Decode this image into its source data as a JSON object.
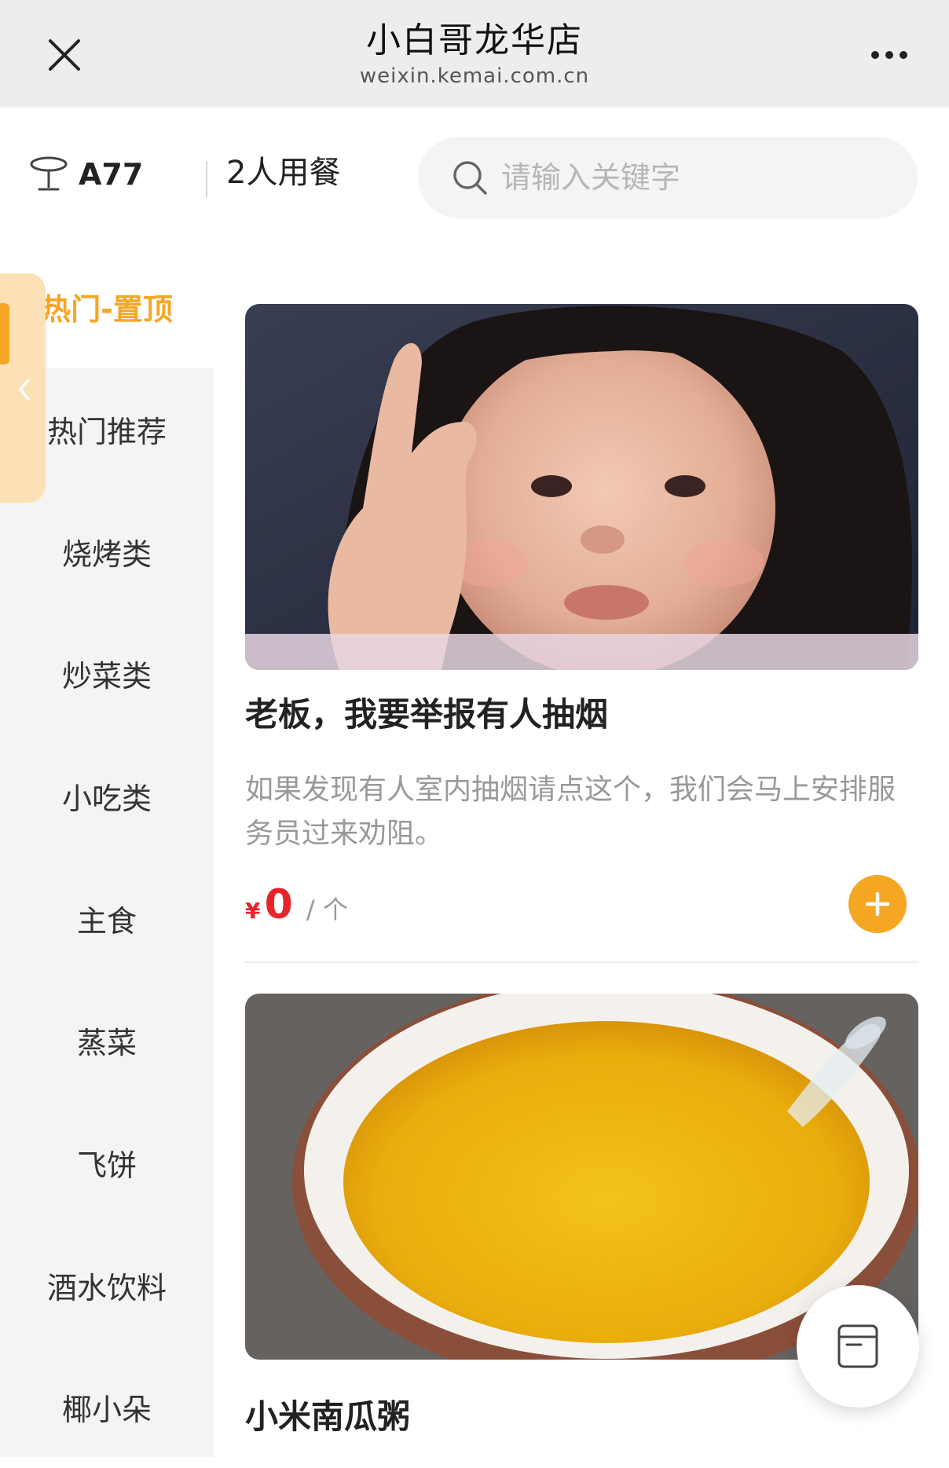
{
  "window": {
    "title": "小白哥龙华店",
    "subtitle": "weixin.kemai.com.cn"
  },
  "topbar": {
    "table_no": "A77",
    "diners": "2人用餐",
    "search_placeholder": "请输入关键字"
  },
  "sidebar": {
    "categories": [
      {
        "label": "热门-置顶",
        "active": true
      },
      {
        "label": "热门推荐",
        "active": false
      },
      {
        "label": "烧烤类",
        "active": false
      },
      {
        "label": "炒菜类",
        "active": false
      },
      {
        "label": "小吃类",
        "active": false
      },
      {
        "label": "主食",
        "active": false
      },
      {
        "label": "蒸菜",
        "active": false
      },
      {
        "label": "飞饼",
        "active": false
      },
      {
        "label": "酒水饮料",
        "active": false
      },
      {
        "label": "椰小朵",
        "active": false
      }
    ]
  },
  "dishes": [
    {
      "name": "老板，我要举报有人抽烟",
      "desc": "如果发现有人室内抽烟请点这个，我们会马上安排服务员过来劝阻。",
      "currency": "¥",
      "price": "0",
      "unit": "/ 个"
    },
    {
      "name": "小米南瓜粥"
    }
  ],
  "colors": {
    "accent": "#f5a623",
    "price": "#e8242b",
    "sidebar_bg": "#f4f4f4",
    "titlebar_bg": "#ededed"
  },
  "icons": [
    "close-icon",
    "more-icon",
    "table-icon",
    "search-icon",
    "chevron-left-icon",
    "plus-icon",
    "cart-icon"
  ]
}
